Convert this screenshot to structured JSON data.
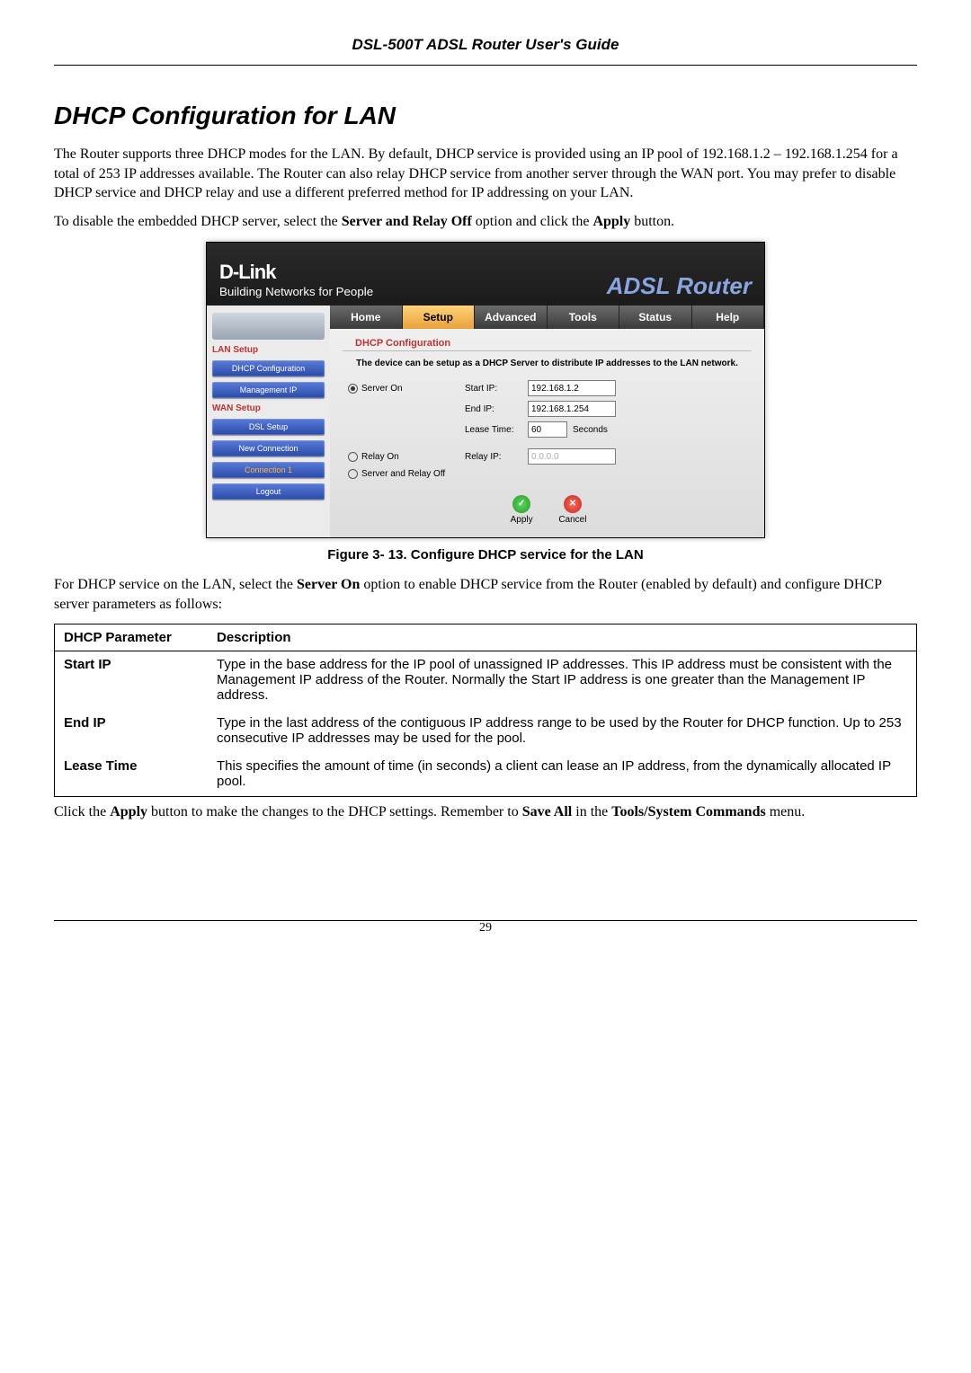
{
  "header": {
    "doc_title": "DSL-500T ADSL Router User's Guide"
  },
  "section": {
    "title": "DHCP Configuration for LAN",
    "para1": "The Router supports three DHCP modes for the LAN. By default, DHCP service is provided using an IP pool of 192.168.1.2 – 192.168.1.254 for a total of 253 IP addresses available. The Router can also relay DHCP service from another server through the WAN port. You may prefer to disable DHCP service and DHCP relay and use a different preferred method for IP addressing on your LAN.",
    "para2_pre": "To disable the embedded DHCP server, select the ",
    "para2_opt": "Server and Relay Off",
    "para2_mid": " option and click the ",
    "para2_btn": "Apply",
    "para2_post": " button."
  },
  "router": {
    "logo": "D-Link",
    "logo_sub": "Building Networks for People",
    "brand": "ADSL Router",
    "tabs": [
      "Home",
      "Setup",
      "Advanced",
      "Tools",
      "Status",
      "Help"
    ],
    "tab_active_index": 1,
    "sidebar": {
      "cat1": "LAN Setup",
      "btn_dhcp": "DHCP Configuration",
      "btn_mgmt": "Management IP",
      "cat2": "WAN Setup",
      "btn_dsl": "DSL Setup",
      "btn_newconn": "New Connection",
      "btn_conn1": "Connection 1",
      "btn_logout": "Logout"
    },
    "panel": {
      "heading": "DHCP Configuration",
      "note": "The device can be setup as a DHCP Server to distribute IP addresses to the LAN network.",
      "opt_server_on": "Server On",
      "opt_relay_on": "Relay On",
      "opt_off": "Server and Relay Off",
      "lbl_start": "Start IP:",
      "val_start": "192.168.1.2",
      "lbl_end": "End IP:",
      "val_end": "192.168.1.254",
      "lbl_lease": "Lease Time:",
      "val_lease": "60",
      "lbl_lease_unit": "Seconds",
      "lbl_relayip": "Relay IP:",
      "val_relayip": "0.0.0.0",
      "btn_apply": "Apply",
      "btn_cancel": "Cancel"
    }
  },
  "fig_caption": "Figure 3- 13. Configure DHCP service for the LAN",
  "after_fig": {
    "pre": "For DHCP service on the LAN, select the ",
    "opt": "Server On",
    "post": " option to enable DHCP service from the Router (enabled by default) and configure DHCP server parameters as follows:"
  },
  "table": {
    "head1": "DHCP Parameter",
    "head2": "Description",
    "rows": [
      {
        "p": "Start IP",
        "d": "Type in the base address for the IP pool of unassigned IP addresses. This IP address must be consistent with the Management IP address of the Router. Normally the Start IP address is one greater than the Management IP address."
      },
      {
        "p": "End IP",
        "d": "Type in the last address of the contiguous IP address range to be used by the Router for DHCP function. Up to 253 consecutive IP addresses may be used for the pool."
      },
      {
        "p": "Lease Time",
        "d": "This specifies the amount of time (in seconds) a client can lease an IP address, from the dynamically allocated IP pool."
      }
    ]
  },
  "closing": {
    "a": "Click the ",
    "b": "Apply",
    "c": " button to make the changes to the DHCP settings. Remember to ",
    "d": "Save All",
    "e": " in the ",
    "f": "Tools/System Commands",
    "g": " menu."
  },
  "page_no": "29"
}
